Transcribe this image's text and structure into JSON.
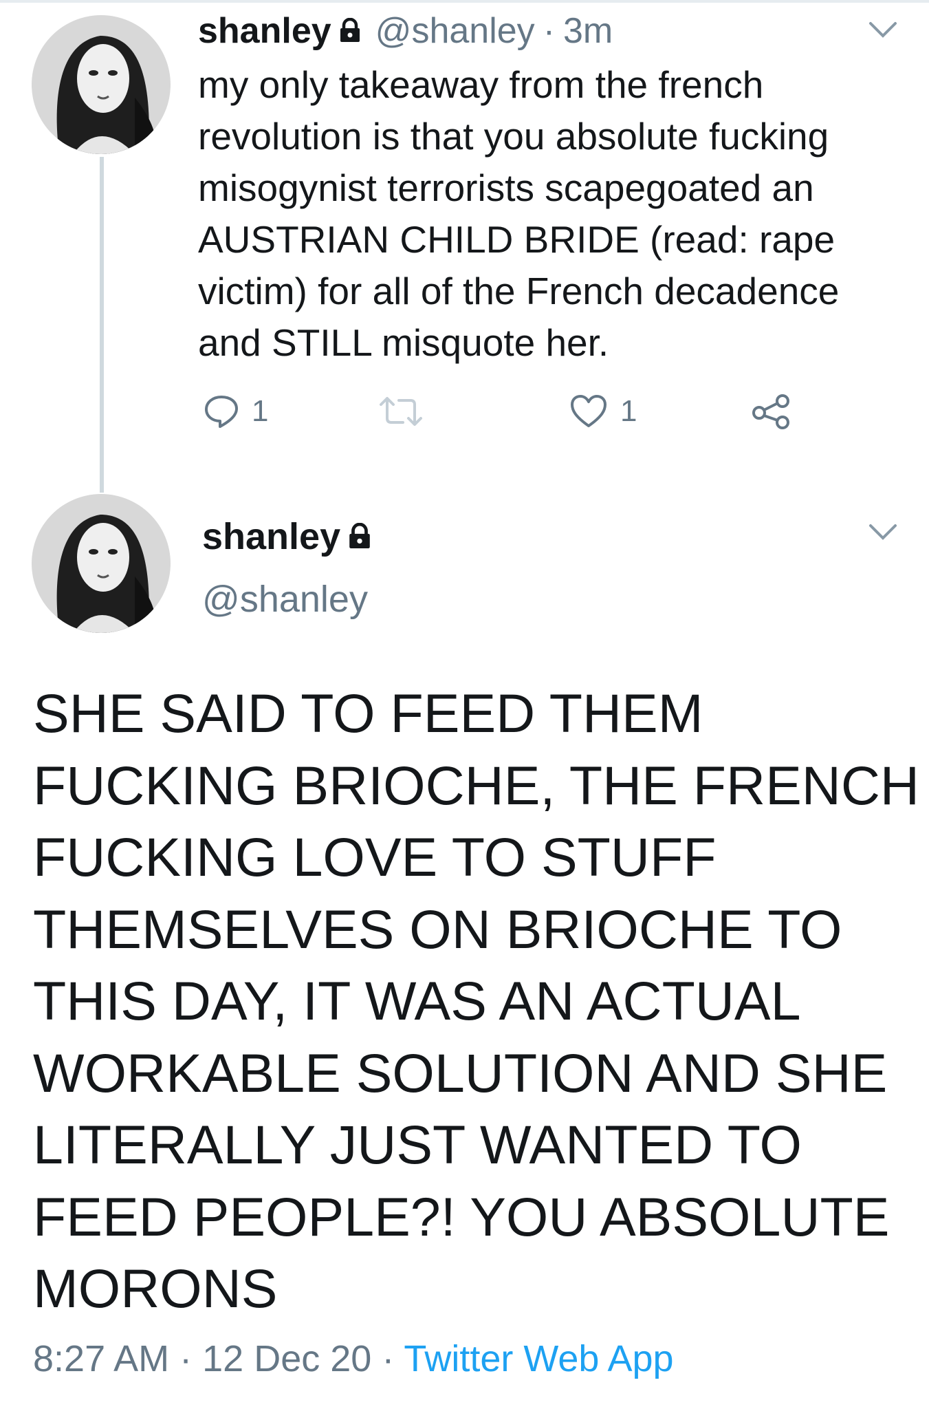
{
  "reply_tweet": {
    "display_name": "shanley",
    "handle": "@shanley",
    "separator": "·",
    "time": "3m",
    "text": "my only takeaway from the french revolution is that you absolute fucking misogynist terrorists scapegoated an AUSTRIAN CHILD BRIDE (read: rape victim) for all of the French decadence and STILL misquote her.",
    "reply_count": "1",
    "retweet_count": "",
    "like_count": "1",
    "icons": [
      "reply-icon",
      "retweet-icon",
      "like-icon",
      "share-icon",
      "chevron-down-icon",
      "lock-icon"
    ]
  },
  "main_tweet": {
    "display_name": "shanley",
    "handle": "@shanley",
    "text": "SHE SAID TO FEED THEM FUCKING BRIOCHE, THE FRENCH FUCKING LOVE TO STUFF THEMSELVES ON BRIOCHE TO THIS DAY, IT WAS AN ACTUAL WORKABLE SOLUTION AND SHE LITERALLY JUST WANTED TO FEED PEOPLE?! YOU ABSOLUTE MORONS",
    "timestamp": "8:27 AM",
    "separator": "·",
    "date": "12 Dec 20",
    "source": "Twitter Web App"
  },
  "colors": {
    "text": "#14171a",
    "secondary": "#657786",
    "link": "#1da1f2",
    "thread_line": "#cfd9de"
  }
}
